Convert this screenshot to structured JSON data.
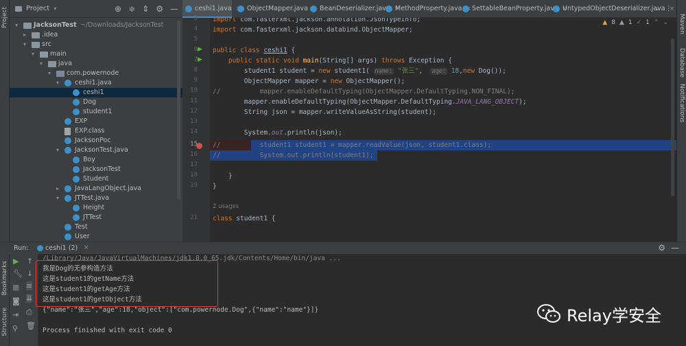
{
  "left_strip": {
    "project_label": "Project",
    "bookmarks_label": "Bookmarks",
    "structure_label": "Structure"
  },
  "project": {
    "header_title": "Project",
    "tree": [
      {
        "label": "JacksonTest",
        "suffix": "~/Downloads/JacksonTest",
        "kind": "folder",
        "depth": 0
      },
      {
        "label": ".idea",
        "kind": "folder",
        "depth": 1
      },
      {
        "label": "src",
        "kind": "folder",
        "depth": 1
      },
      {
        "label": "main",
        "kind": "folder",
        "depth": 2
      },
      {
        "label": "java",
        "kind": "folder",
        "depth": 3
      },
      {
        "label": "com.powernode",
        "kind": "package",
        "depth": 4
      },
      {
        "label": "ceshi1.java",
        "kind": "javafile",
        "depth": 5
      },
      {
        "label": "ceshi1",
        "kind": "class",
        "depth": 6,
        "selected": true
      },
      {
        "label": "Dog",
        "kind": "class",
        "depth": 6
      },
      {
        "label": "student1",
        "kind": "class",
        "depth": 6
      },
      {
        "label": "EXP",
        "kind": "class",
        "depth": 5
      },
      {
        "label": "EXP.class",
        "kind": "binary",
        "depth": 5
      },
      {
        "label": "JacksonPoc",
        "kind": "class",
        "depth": 5
      },
      {
        "label": "JacksonTest.java",
        "kind": "javafile",
        "depth": 5
      },
      {
        "label": "Boy",
        "kind": "class",
        "depth": 6
      },
      {
        "label": "JacksonTest",
        "kind": "class",
        "depth": 6
      },
      {
        "label": "Student",
        "kind": "class",
        "depth": 6
      },
      {
        "label": "JavaLangObject.java",
        "kind": "javafile",
        "depth": 5,
        "collapsed": true
      },
      {
        "label": "JTTest.java",
        "kind": "javafile",
        "depth": 5
      },
      {
        "label": "Height",
        "kind": "class",
        "depth": 6
      },
      {
        "label": "JTTest",
        "kind": "class",
        "depth": 6
      },
      {
        "label": "Test",
        "kind": "class",
        "depth": 5
      },
      {
        "label": "User",
        "kind": "class",
        "depth": 5
      }
    ]
  },
  "tabs": [
    {
      "label": "ceshi1.java",
      "active": true
    },
    {
      "label": "ObjectMapper.java"
    },
    {
      "label": "BeanDeserializer.java"
    },
    {
      "label": "MethodProperty.java"
    },
    {
      "label": "SettableBeanProperty.java"
    },
    {
      "label": "UntypedObjectDeserializer.java"
    }
  ],
  "inspections": {
    "warnings": "8",
    "weak_warnings": "1",
    "typos": "1"
  },
  "right_strip": {
    "maven_label": "Maven",
    "database_label": "Database",
    "notifications_label": "Notifications"
  },
  "editor": {
    "line_numbers": [
      "3",
      "4",
      "5",
      "6",
      "7",
      "8",
      "9",
      "10",
      "11",
      "12",
      "13",
      "14",
      "15",
      "16",
      "17",
      "18",
      "19",
      "",
      "21"
    ],
    "usages": "2 usages"
  },
  "run": {
    "label": "Run:",
    "tab_label": "ceshi1 (2)",
    "output": [
      "/Library/Java/JavaVirtualMachines/jdk1.8.0_65.jdk/Contents/Home/bin/java ...",
      "我是Dog的无参构造方法",
      "这是student1的getName方法",
      "这是student1的getAge方法",
      "这是student1的getObject方法",
      "{\"name\":\"张三\",\"age\":18,\"object\":[\"com.powernode.Dog\",{\"name\":\"name\"}]}",
      "",
      "Process finished with exit code 0"
    ]
  },
  "watermark": {
    "text": "Relay学安全"
  },
  "colors": {
    "keyword": "#cc7832",
    "method": "#ffc66d",
    "string": "#6a8759",
    "number": "#6897bb",
    "comment": "#808080",
    "selection": "#214283",
    "highlight_box": "#e03c31"
  }
}
